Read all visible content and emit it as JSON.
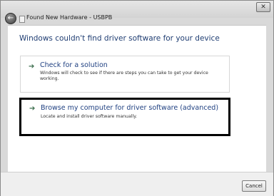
{
  "window": {
    "title": "Found New Hardware - USBPB",
    "close_glyph": "✕"
  },
  "content": {
    "heading": "Windows couldn't find driver software for your device",
    "options": [
      {
        "title": "Check for a solution",
        "description": "Windows will check to see if there are steps you can take to get your device working.",
        "icon": "green-arrow-icon"
      },
      {
        "title": "Browse my computer for driver software (advanced)",
        "description": "Locate and install driver software manually.",
        "icon": "green-arrow-icon",
        "highlighted": true
      }
    ]
  },
  "footer": {
    "cancel_label": "Cancel"
  },
  "colors": {
    "heading": "#1f3d72",
    "link": "#1e3f80",
    "arrow": "#3b6d4c",
    "highlight_border": "#000000"
  }
}
